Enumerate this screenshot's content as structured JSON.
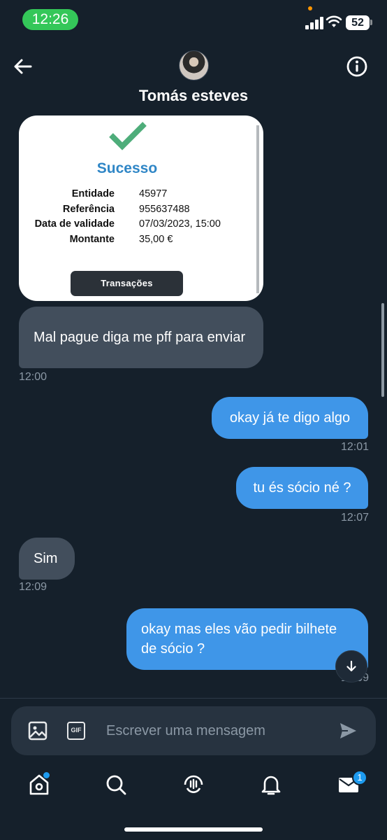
{
  "status_bar": {
    "time": "12:26",
    "battery": "52"
  },
  "header": {
    "contact_name": "Tomás esteves"
  },
  "receipt": {
    "title": "Sucesso",
    "rows": [
      {
        "label": "Entidade",
        "value": "45977"
      },
      {
        "label": "Referência",
        "value": "955637488"
      },
      {
        "label": "Data de validade",
        "value": "07/03/2023, 15:00"
      },
      {
        "label": "Montante",
        "value": "35,00 €"
      }
    ],
    "button_label": "Transações"
  },
  "messages": [
    {
      "direction": "in",
      "text": "Mal pague diga me pff para enviar",
      "time": "12:00"
    },
    {
      "direction": "out",
      "text": "okay já te digo algo",
      "time": "12:01"
    },
    {
      "direction": "out",
      "text": "tu és sócio né ?",
      "time": "12:07"
    },
    {
      "direction": "in",
      "text": "Sim",
      "time": "12:09"
    },
    {
      "direction": "out",
      "text": "okay mas eles vão pedir bilhete de sócio ?",
      "time": "12:09"
    }
  ],
  "composer": {
    "placeholder": "Escrever uma mensagem",
    "gif_label": "GIF"
  },
  "bottom_nav": {
    "items": [
      "home-icon",
      "search-icon",
      "spaces-icon",
      "bell-icon",
      "mail-icon"
    ],
    "messages_badge": "1"
  },
  "colors": {
    "background": "#15202b",
    "outgoing_bubble": "#3f96e8",
    "incoming_bubble": "#424e5c",
    "success_green": "#4ead7a",
    "accent": "#1d9bf0"
  }
}
